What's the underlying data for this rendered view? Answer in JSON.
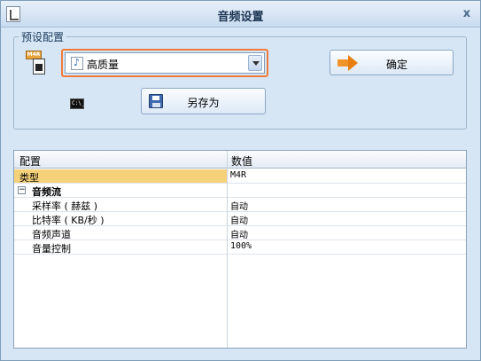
{
  "window": {
    "title": "音频设置",
    "close_glyph": "x"
  },
  "preset": {
    "group_label": "预设配置",
    "format_badge": "M4R",
    "selected": "高质量",
    "ok_label": "确定",
    "save_as_label": "另存为",
    "cmd_label": "C:\\_"
  },
  "grid": {
    "headers": [
      "配置",
      "数值"
    ],
    "type_row": {
      "name": "类型",
      "value": "M4R"
    },
    "category": {
      "toggle": "−",
      "name": "音频流"
    },
    "rows": [
      {
        "name": "采样率 ( 赫兹 )",
        "value": "自动"
      },
      {
        "name": "比特率 ( KB/秒 )",
        "value": "自动"
      },
      {
        "name": "音频声道",
        "value": "自动"
      },
      {
        "name": "音量控制",
        "value": "100%"
      }
    ]
  },
  "colors": {
    "highlight": "#f07a3a",
    "selection": "#f5d27a",
    "accent_arrow": "#e67e10"
  }
}
